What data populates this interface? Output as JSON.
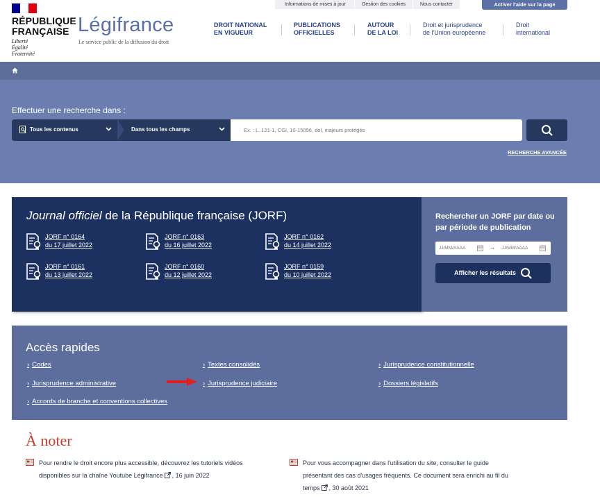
{
  "header": {
    "republic_lines": [
      "RÉPUBLIQUE",
      "FRANÇAISE"
    ],
    "motto": [
      "Liberté",
      "Égalité",
      "Fraternité"
    ],
    "brand": "Légifrance",
    "tagline": "Le service public de la diffusion du droit",
    "top_links": [
      "Informations de mises à jour",
      "Gestion des cookies",
      "Nous contacter"
    ],
    "help_button": "Activer l'aide sur la page",
    "nav": [
      {
        "line1": "DROIT NATIONAL",
        "line2": "EN VIGUEUR"
      },
      {
        "line1": "PUBLICATIONS",
        "line2": "OFFICIELLES"
      },
      {
        "line1": "AUTOUR",
        "line2": "DE LA LOI"
      },
      {
        "line1": "Droit et jurisprudence",
        "line2": "de l'Union européenne"
      },
      {
        "line1": "Droit",
        "line2": "international"
      }
    ],
    "flag_colors": [
      "#000091",
      "#ffffff",
      "#e1000f"
    ]
  },
  "search": {
    "label": "Effectuer une recherche dans :",
    "scope": "Tous les contenus",
    "field": "Dans tous les champs",
    "placeholder": "Ex. : L. 121-1, CGI, 10-15056, dol, majeurs protégés",
    "advanced": "RECHERCHE AVANCÉE"
  },
  "jorf": {
    "title_italic": "Journal officiel",
    "title_rest": " de la République française (JORF)",
    "items": [
      {
        "num": "JORF n° 0164",
        "date": "du 17 juillet 2022"
      },
      {
        "num": "JORF n° 0163",
        "date": "du 16 juillet 2022"
      },
      {
        "num": "JORF n° 0162",
        "date": "du 14 juillet 2022"
      },
      {
        "num": "JORF n° 0161",
        "date": "du 13 juillet 2022"
      },
      {
        "num": "JORF n° 0160",
        "date": "du 12 juillet 2022"
      },
      {
        "num": "JORF n° 0159",
        "date": "du 10 juillet 2022"
      }
    ],
    "date_search_title": "Rechercher un JORF par date ou par période de publication",
    "date_placeholder": "JJ/MM/AAAA",
    "show_results": "Afficher les résultats"
  },
  "quick_access": {
    "title": "Accès rapides",
    "links": [
      "Codes",
      "Textes consolidés",
      "Jurisprudence constitutionnelle",
      "Jurisprudence administrative",
      "Jurisprudence judiciaire",
      "Dossiers législatifs",
      "Accords de branche et conventions collectives"
    ]
  },
  "notes": {
    "title": "À noter",
    "items": [
      {
        "line1": "Pour rendre le droit encore plus accessible, découvrez les tutoriels vidéos",
        "line2": "disponibles sur la chaîne Youtube Légifrance",
        "date": ", 16 juin 2022"
      },
      {
        "line1": "Pour vous accompagner dans l'utilisation du site, consulter le guide",
        "line2": "présentant des cas d'usages fréquents. Ce document sera enrichi au fil du",
        "line3": "temps",
        "date": ", 30 août 2021"
      }
    ]
  },
  "colors": {
    "navy": "#1d3160",
    "band": "#6b7eaf",
    "panel": "#5d6e9e",
    "accent_red": "#c43a28",
    "annotation_arrow": "#e02020"
  }
}
